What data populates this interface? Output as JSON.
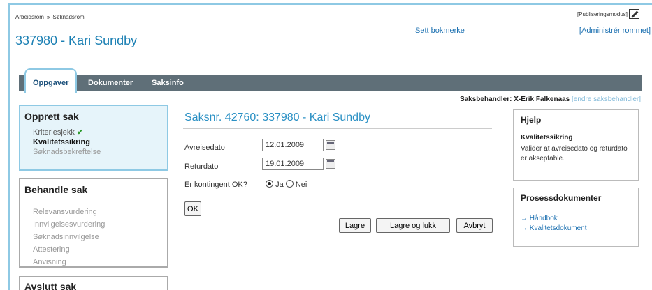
{
  "breadcrumb": {
    "root": "Arbeidsrom",
    "separator": "»",
    "current": "Søknadsrom"
  },
  "publish_mode": "[Publiseringsmodus]",
  "header": {
    "title": "337980 - Kari Sundby",
    "bookmark": "Sett bokmerke",
    "admin": "[Administrér rommet]"
  },
  "tabs": [
    {
      "label": "Oppgaver"
    },
    {
      "label": "Dokumenter"
    },
    {
      "label": "Saksinfo"
    }
  ],
  "handler": {
    "label": "Saksbehandler: X-Erik Falkenaas",
    "change": "[endre saksbehandler]"
  },
  "sections": [
    {
      "title": "Opprett sak",
      "items": [
        "Kriteriesjekk",
        "Kvalitetssikring",
        "Søknadsbekreftelse"
      ],
      "check": "✔"
    },
    {
      "title": "Behandle sak",
      "items": [
        "Relevansvurdering",
        "Innvilgelsesvurdering",
        "Søknadsinnvilgelse",
        "Attestering",
        "Anvisning"
      ]
    },
    {
      "title": "Avslutt sak"
    }
  ],
  "form": {
    "title": "Saksnr. 42760: 337980 - Kari Sundby",
    "departure_label": "Avreisedato",
    "departure_value": "12.01.2009",
    "return_label": "Returdato",
    "return_value": "19.01.2009",
    "quota_label": "Er kontingent OK?",
    "yes": "Ja",
    "no": "Nei",
    "ok": "OK",
    "save": "Lagre",
    "save_close": "Lagre og lukk",
    "cancel": "Avbryt"
  },
  "help": {
    "title": "Hjelp",
    "subtitle": "Kvalitetssikring",
    "text": "Valider at avreisedato og returdato er akseptable."
  },
  "process_docs": {
    "title": "Prosessdokumenter",
    "links": [
      "→ Håndbok",
      "→ Kvalitetsdokument"
    ]
  },
  "colors": {
    "accent": "#2a90c4",
    "tabbar": "#5f6f78",
    "active_bg": "#e6f4fa",
    "check": "#2e9b2e"
  }
}
